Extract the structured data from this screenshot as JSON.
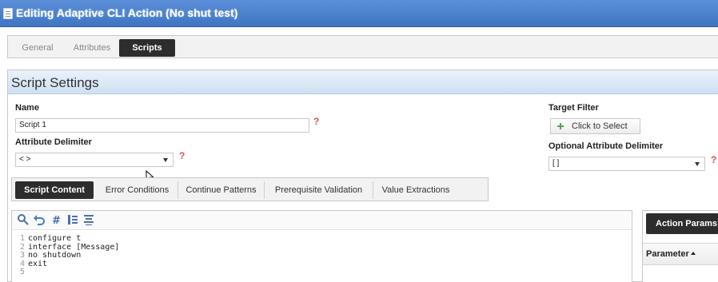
{
  "window": {
    "title": "Editing Adaptive CLI Action (No shut test)"
  },
  "top_tabs": [
    {
      "label": "General"
    },
    {
      "label": "Attributes"
    },
    {
      "label": "Scripts",
      "selected": true
    }
  ],
  "panel": {
    "title": "Script Settings"
  },
  "form": {
    "name_label": "Name",
    "name_value": "Script 1",
    "attr_delim_label": "Attribute Delimiter",
    "attr_delim_value": "< >",
    "target_filter_label": "Target Filter",
    "target_filter_button": "Click to Select",
    "opt_attr_delim_label": "Optional Attribute Delimiter",
    "opt_attr_delim_value": "[ ]",
    "required_marker": "?"
  },
  "sub_tabs": [
    {
      "label": "Script Content",
      "selected": true
    },
    {
      "label": "Error Conditions"
    },
    {
      "label": "Continue Patterns"
    },
    {
      "label": "Prerequisite Validation"
    },
    {
      "label": "Value Extractions"
    }
  ],
  "editor": {
    "toolbar": [
      "search-icon",
      "undo-icon",
      "line-numbers-icon",
      "align-icon",
      "format-icon"
    ],
    "lines": [
      {
        "n": "1",
        "text": "configure t"
      },
      {
        "n": "2",
        "text": "interface [Message]"
      },
      {
        "n": "3",
        "text": "no shutdown"
      },
      {
        "n": "4",
        "text": "exit"
      },
      {
        "n": "5",
        "text": ""
      }
    ]
  },
  "right_panel": {
    "button": "Action Params",
    "column_header": "Parameter"
  },
  "colors": {
    "title_bar": "#4a80cc",
    "selected_tab": "#2d2d2d",
    "required": "#d9534f"
  }
}
